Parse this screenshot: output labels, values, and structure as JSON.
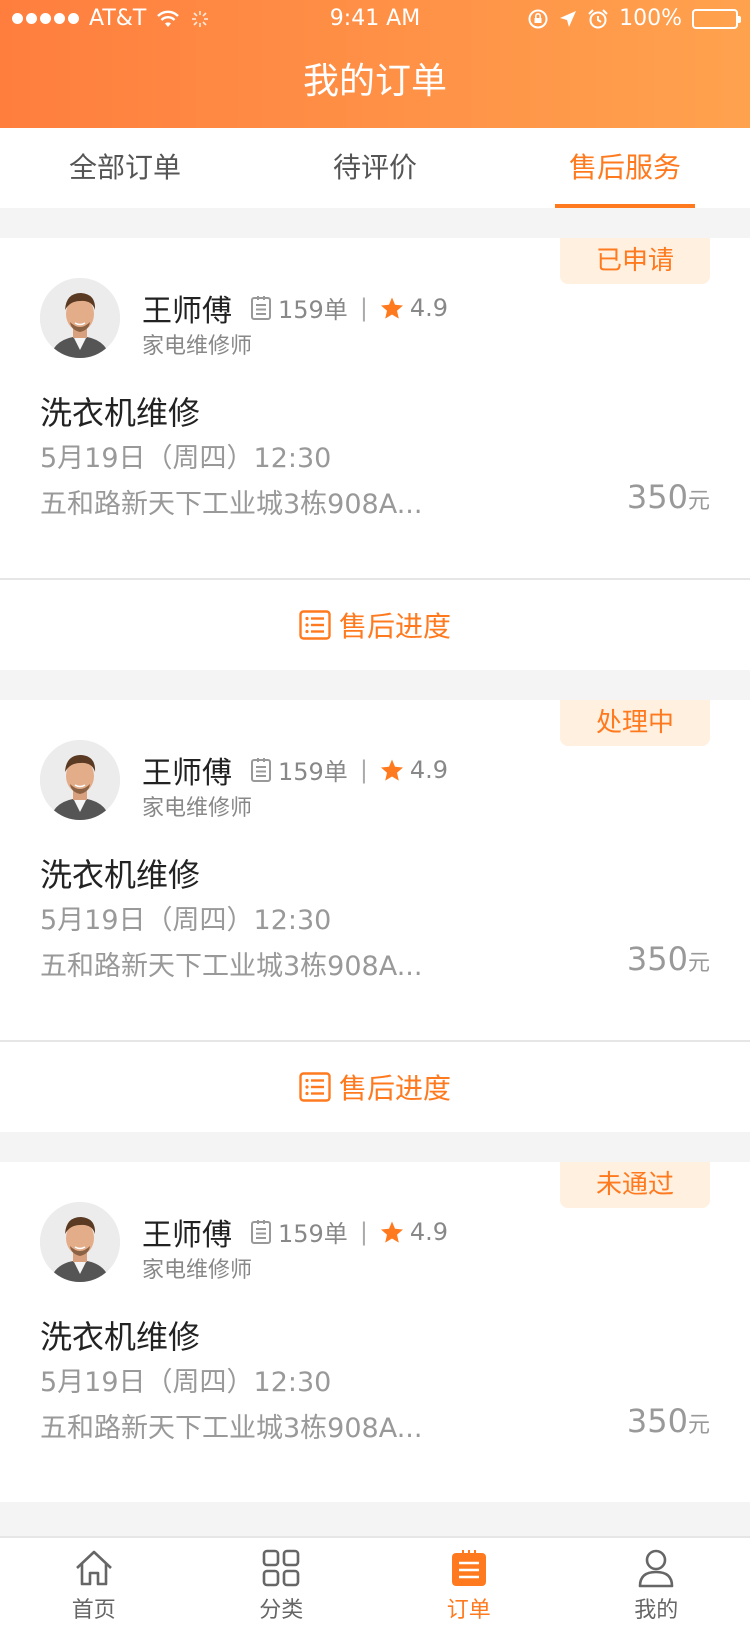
{
  "status_bar": {
    "carrier": "AT&T",
    "time": "9:41 AM",
    "battery": "100%"
  },
  "header": {
    "title": "我的订单"
  },
  "tabs": [
    {
      "label": "全部订单"
    },
    {
      "label": "待评价"
    },
    {
      "label": "售后服务"
    }
  ],
  "orders": [
    {
      "status": "已申请",
      "worker_name": "王师傅",
      "order_count": "159单",
      "rating": "4.9",
      "role": "家电维修师",
      "service": "洗衣机维修",
      "datetime": "5月19日（周四）12:30",
      "address": "五和路新天下工业城3栋908A...",
      "price": "350",
      "price_unit": "元",
      "action_label": "售后进度"
    },
    {
      "status": "处理中",
      "worker_name": "王师傅",
      "order_count": "159单",
      "rating": "4.9",
      "role": "家电维修师",
      "service": "洗衣机维修",
      "datetime": "5月19日（周四）12:30",
      "address": "五和路新天下工业城3栋908A...",
      "price": "350",
      "price_unit": "元",
      "action_label": "售后进度"
    },
    {
      "status": "未通过",
      "worker_name": "王师傅",
      "order_count": "159单",
      "rating": "4.9",
      "role": "家电维修师",
      "service": "洗衣机维修",
      "datetime": "5月19日（周四）12:30",
      "address": "五和路新天下工业城3栋908A...",
      "price": "350",
      "price_unit": "元"
    }
  ],
  "bottom_nav": [
    {
      "label": "首页",
      "icon": "home-icon"
    },
    {
      "label": "分类",
      "icon": "grid-icon"
    },
    {
      "label": "订单",
      "icon": "order-icon"
    },
    {
      "label": "我的",
      "icon": "user-icon"
    }
  ],
  "colors": {
    "accent": "#ff7a1f",
    "header_start": "#ff7e3e",
    "header_end": "#ffa24e",
    "badge_bg": "#fff0e0"
  }
}
